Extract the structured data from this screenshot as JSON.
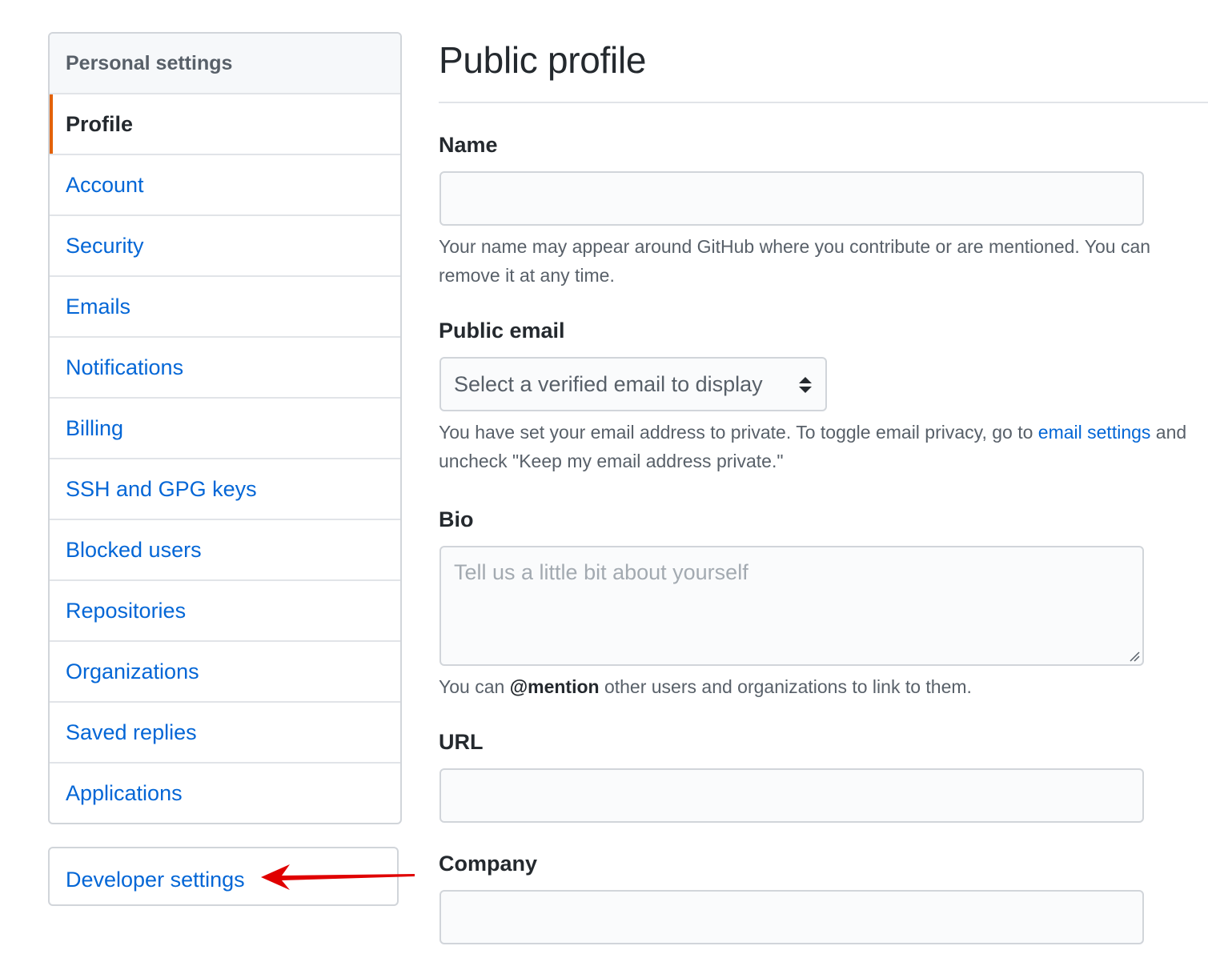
{
  "sidebar": {
    "heading": "Personal settings",
    "items": [
      {
        "label": "Profile",
        "selected": true
      },
      {
        "label": "Account"
      },
      {
        "label": "Security"
      },
      {
        "label": "Emails"
      },
      {
        "label": "Notifications"
      },
      {
        "label": "Billing"
      },
      {
        "label": "SSH and GPG keys"
      },
      {
        "label": "Blocked users"
      },
      {
        "label": "Repositories"
      },
      {
        "label": "Organizations"
      },
      {
        "label": "Saved replies"
      },
      {
        "label": "Applications"
      }
    ],
    "developer_settings": "Developer settings"
  },
  "main": {
    "title": "Public profile",
    "name": {
      "label": "Name",
      "value": "",
      "note": "Your name may appear around GitHub where you contribute or are mentioned. You can remove it at any time."
    },
    "public_email": {
      "label": "Public email",
      "selected": "Select a verified email to display",
      "note_before": "You have set your email address to private. To toggle email privacy, go to ",
      "note_link": "email settings",
      "note_after": " and uncheck \"Keep my email address private.\""
    },
    "bio": {
      "label": "Bio",
      "placeholder": "Tell us a little bit about yourself",
      "note_before": "You can ",
      "note_mention": "@mention",
      "note_after": " other users and organizations to link to them."
    },
    "url": {
      "label": "URL",
      "value": ""
    },
    "company": {
      "label": "Company",
      "value": ""
    }
  },
  "colors": {
    "link": "#0366d6",
    "selected_indicator": "#e36209",
    "annotation_arrow": "#e00000"
  }
}
